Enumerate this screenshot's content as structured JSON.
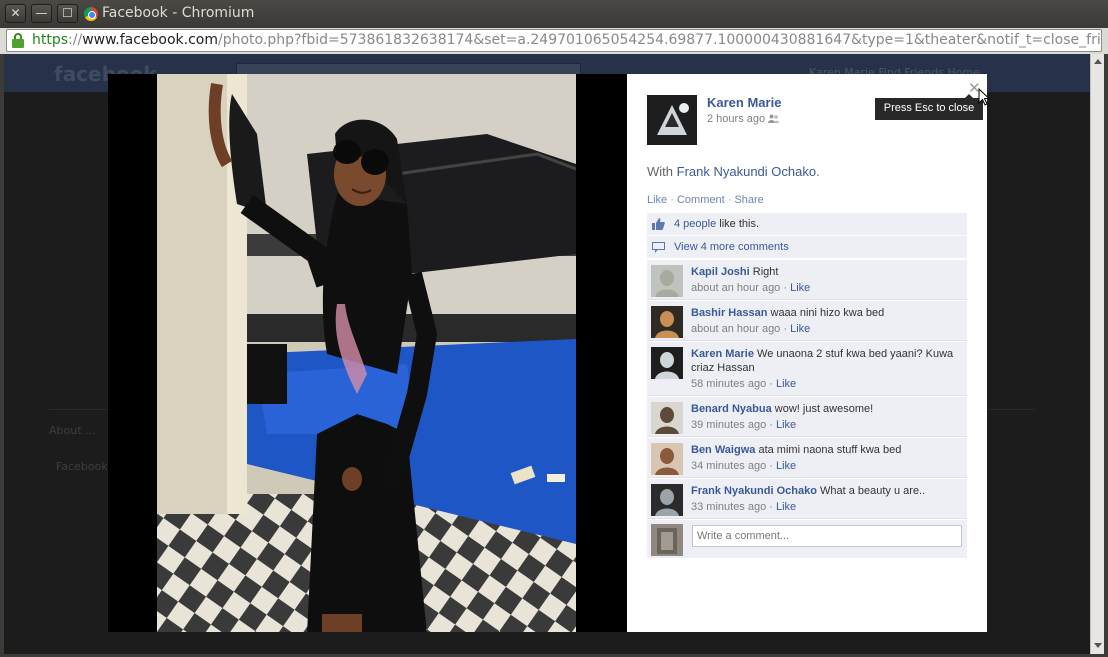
{
  "window": {
    "title": "Facebook - Chromium",
    "close_glyph": "✕",
    "min_glyph": "—",
    "max_glyph": "☐"
  },
  "addressbar": {
    "scheme": "https",
    "separator": "://",
    "host": "www.facebook.com",
    "path": "/photo.php?fbid=573861832638174&set=a.249701065054254.69877.100000430881647&type=1&theater&notif_t=close_friend_activi"
  },
  "background": {
    "logo": "facebook",
    "nav": "Karen Marie   Find Friends   Home",
    "footer_links": "About    ...",
    "footer_copy": "Facebook ..."
  },
  "post": {
    "owner": "Karen Marie",
    "time": "2 hours ago",
    "with_prefix": "With ",
    "with_name": "Frank Nyakundi Ochako",
    "with_suffix": ".",
    "actions": {
      "like": "Like",
      "comment": "Comment",
      "share": "Share",
      "sep": " · "
    }
  },
  "ufi": {
    "likes_link": "4 people",
    "likes_text": " like this.",
    "more_comments": "View 4 more comments",
    "comments": [
      {
        "author": "Kapil Joshi",
        "text": "Right",
        "time": "about an hour ago",
        "like": "Like"
      },
      {
        "author": "Bashir Hassan",
        "text": "waaa nini hizo kwa bed",
        "time": "about an hour ago",
        "like": "Like"
      },
      {
        "author": "Karen Marie",
        "text": "We unaona 2 stuf kwa bed yaani? Kuwa criaz Hassan",
        "time": "58 minutes ago",
        "like": "Like"
      },
      {
        "author": "Benard Nyabua",
        "text": "wow! just awesome!",
        "time": "39 minutes ago",
        "like": "Like"
      },
      {
        "author": "Ben Waigwa",
        "text": "ata mimi naona stuff kwa bed",
        "time": "34 minutes ago",
        "like": "Like"
      },
      {
        "author": "Frank Nyakundi Ochako",
        "text": "What a beauty u are..",
        "time": "33 minutes ago",
        "like": "Like"
      }
    ],
    "placeholder": "Write a comment..."
  },
  "theater": {
    "close_glyph": "✕",
    "tooltip": "Press Esc to close"
  },
  "colors": {
    "link": "#3b5998",
    "ufi_bg": "#edeff4",
    "secure_green": "#1f8a16"
  }
}
